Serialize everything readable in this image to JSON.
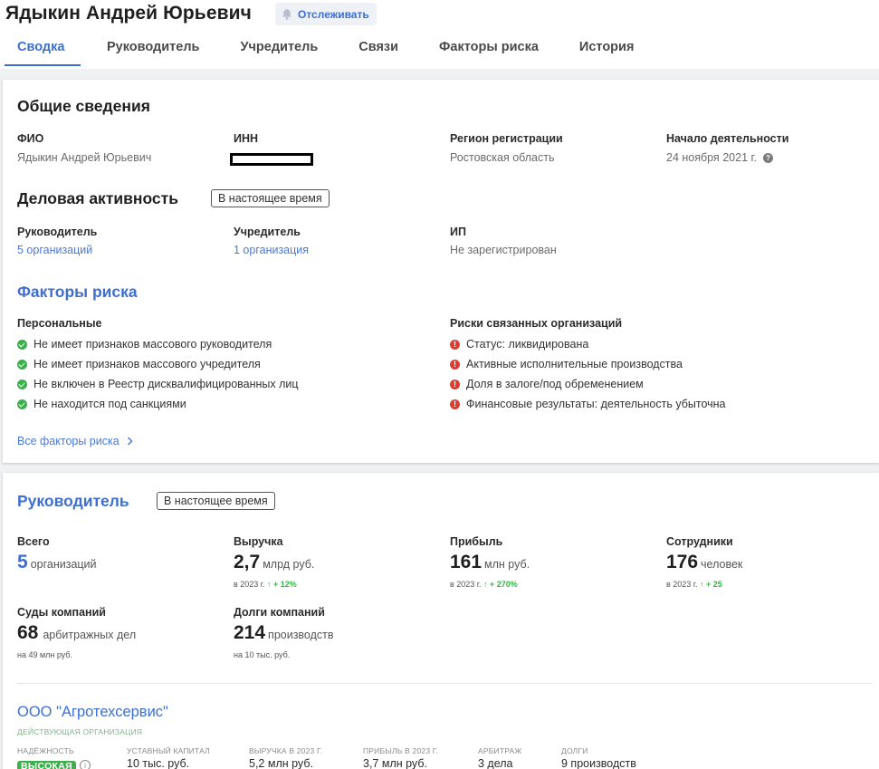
{
  "header": {
    "name": "Ядыкин Андрей Юрьевич",
    "follow_label": "Отслеживать",
    "tabs": [
      "Сводка",
      "Руководитель",
      "Учредитель",
      "Связи",
      "Факторы риска",
      "История"
    ]
  },
  "general": {
    "title": "Общие сведения",
    "fio_label": "ФИО",
    "fio_value": "Ядыкин Андрей Юрьевич",
    "inn_label": "ИНН",
    "region_label": "Регион регистрации",
    "region_value": "Ростовская область",
    "start_label": "Начало деятельности",
    "start_value": "24 ноября 2021 г."
  },
  "business": {
    "title": "Деловая активность",
    "period": "В настоящее время",
    "director_label": "Руководитель",
    "director_value": "5 организаций",
    "founder_label": "Учредитель",
    "founder_value": "1 организация",
    "ip_label": "ИП",
    "ip_value": "Не зарегистрирован"
  },
  "risks": {
    "title": "Факторы риска",
    "personal_label": "Персональные",
    "personal": [
      "Не имеет признаков массового руководителя",
      "Не имеет признаков массового учредителя",
      "Не включен в Реестр дисквалифицированных лиц",
      "Не находится под санкциями"
    ],
    "related_label": "Риски связанных организаций",
    "related": [
      "Статус: ликвидирована",
      "Активные исполнительные производства",
      "Доля в залоге/под обременением",
      "Финансовые результаты: деятельность убыточна"
    ],
    "all_link": "Все факторы риска"
  },
  "director": {
    "title": "Руководитель",
    "period": "В настоящее время",
    "total_label": "Всего",
    "total_num": "5",
    "total_unit": "организаций",
    "revenue_label": "Выручка",
    "revenue_num": "2,7",
    "revenue_unit": "млрд руб.",
    "revenue_note": "в 2023 г.",
    "revenue_growth": "↑ + 12%",
    "profit_label": "Прибыль",
    "profit_num": "161",
    "profit_unit": "млн руб.",
    "profit_note": "в 2023 г.",
    "profit_growth": "↑ + 270%",
    "staff_label": "Сотрудники",
    "staff_num": "176",
    "staff_unit": "человек",
    "staff_note": "в 2023 г.",
    "staff_growth": "↑ + 25",
    "courts_label": "Суды компаний",
    "courts_num": "68",
    "courts_unit": "арбитражных дел",
    "courts_note": "на 49 млн руб.",
    "debts_label": "Долги компаний",
    "debts_num": "214",
    "debts_unit": "производств",
    "debts_note": "на 10 тыс. руб."
  },
  "org": {
    "name": "ООО \"Агротехсервис\"",
    "status": "Действующая организация",
    "reliability_label": "Надёжность",
    "reliability_value": "ВЫСОКАЯ",
    "capital_label": "Уставный капитал",
    "capital_value": "10 тыс. руб.",
    "revenue_label": "Выручка в 2023 г.",
    "revenue_value": "5,2 млн руб.",
    "profit_label": "Прибыль в 2023 г.",
    "profit_value": "3,7 млн руб.",
    "arbitr_label": "Арбитраж",
    "arbitr_value": "3 дела",
    "debts_label": "Долги",
    "debts_value": "9 производств"
  },
  "colors": {
    "accent": "#3d6fd1",
    "ok": "#3bb14a",
    "danger": "#e23b2e"
  }
}
